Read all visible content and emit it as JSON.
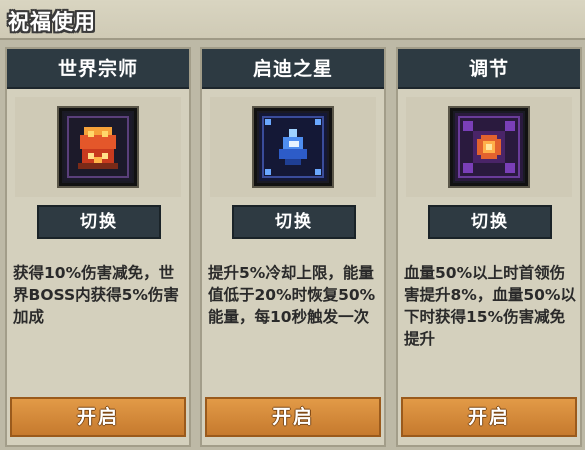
{
  "window": {
    "title": "祝福使用"
  },
  "cards": [
    {
      "name": "世界宗师",
      "icon": "fire-crown-icon",
      "switch_label": "切换",
      "description": "获得10%伤害减免，世界BOSS内获得5%伤害加成",
      "open_label": "开启"
    },
    {
      "name": "启迪之星",
      "icon": "blue-star-icon",
      "switch_label": "切换",
      "description": "提升5%冷却上限，能量值低于20%时恢复50%能量，每10秒触发一次",
      "open_label": "开启"
    },
    {
      "name": "调节",
      "icon": "orange-burst-icon",
      "switch_label": "切换",
      "description": "血量50%以上时首领伤害提升8%，血量50%以下时获得15%伤害减免提升",
      "open_label": "开启"
    }
  ],
  "colors": {
    "header": "#2d3a42",
    "open_button": "#d88a3a",
    "panel": "#d4d0bd"
  }
}
